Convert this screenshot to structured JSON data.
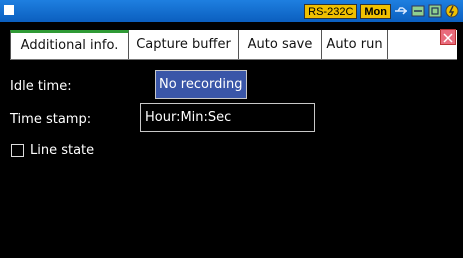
{
  "status_bar": {
    "port": "RS-232C",
    "mode": "Mon",
    "icons": [
      "usb-icon",
      "network-icon",
      "card-icon",
      "power-icon"
    ]
  },
  "tabs": [
    {
      "label": "Additional info.",
      "active": true
    },
    {
      "label": "Capture buffer",
      "active": false
    },
    {
      "label": "Auto save",
      "active": false
    },
    {
      "label": "Auto run",
      "active": false
    }
  ],
  "form": {
    "idle_label": "Idle time:",
    "idle_value": "No recording",
    "stamp_label": "Time stamp:",
    "stamp_value": "Hour:Min:Sec",
    "line_state_label": "Line state",
    "line_state_checked": false
  },
  "colors": {
    "topbar": "#0b5fbf",
    "active_tab_accent": "#2f9a35",
    "selected_field": "#3a56a8",
    "close_button": "#e96b7d"
  }
}
